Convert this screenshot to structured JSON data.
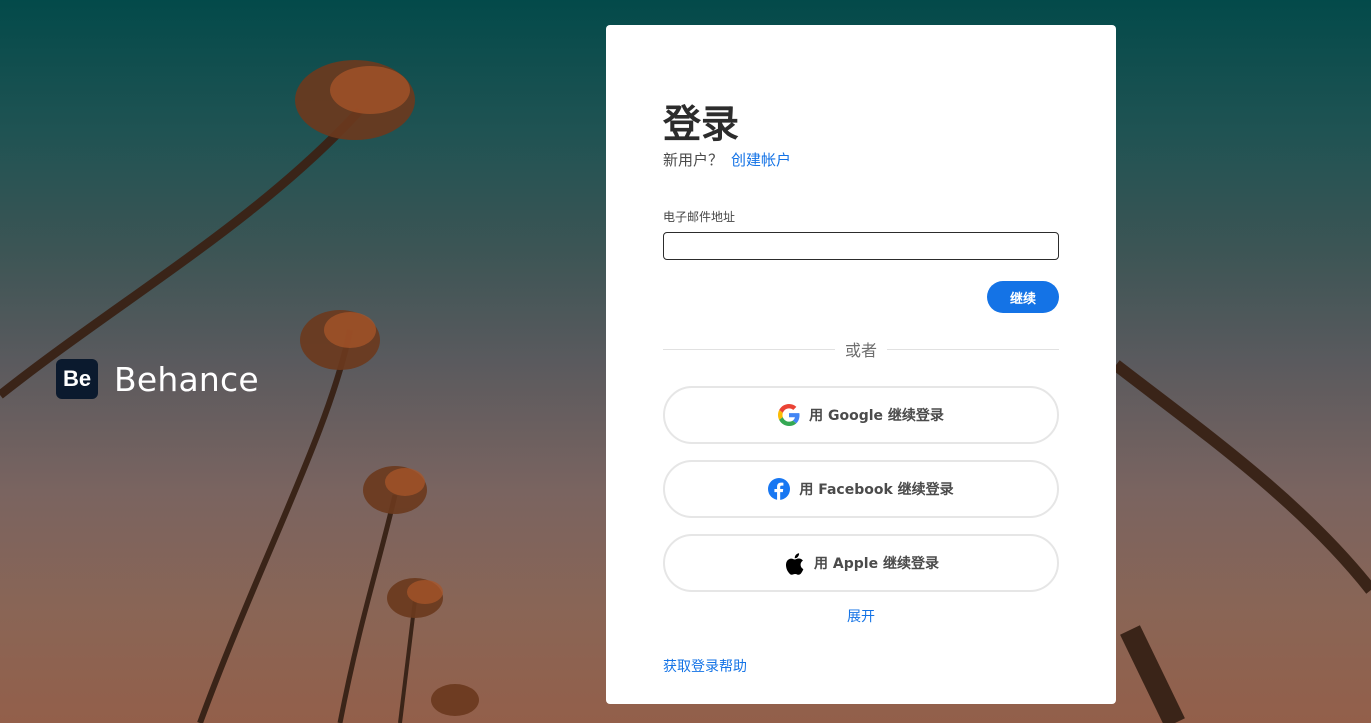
{
  "brand": {
    "logo_text": "Be",
    "name": "Behance"
  },
  "signin": {
    "title": "登录",
    "new_user_text": "新用户？",
    "create_account_link": "创建帐户",
    "email_label": "电子邮件地址",
    "email_value": "",
    "continue_label": "继续",
    "divider_text": "或者",
    "social": [
      {
        "provider": "google",
        "label": "用 Google 继续登录",
        "icon": "google-icon"
      },
      {
        "provider": "facebook",
        "label": "用 Facebook 继续登录",
        "icon": "facebook-icon"
      },
      {
        "provider": "apple",
        "label": "用 Apple 继续登录",
        "icon": "apple-icon"
      }
    ],
    "expand_label": "展开",
    "help_link": "获取登录帮助"
  },
  "colors": {
    "accent": "#1473e6",
    "facebook": "#1877f2",
    "card_bg": "#ffffff"
  }
}
